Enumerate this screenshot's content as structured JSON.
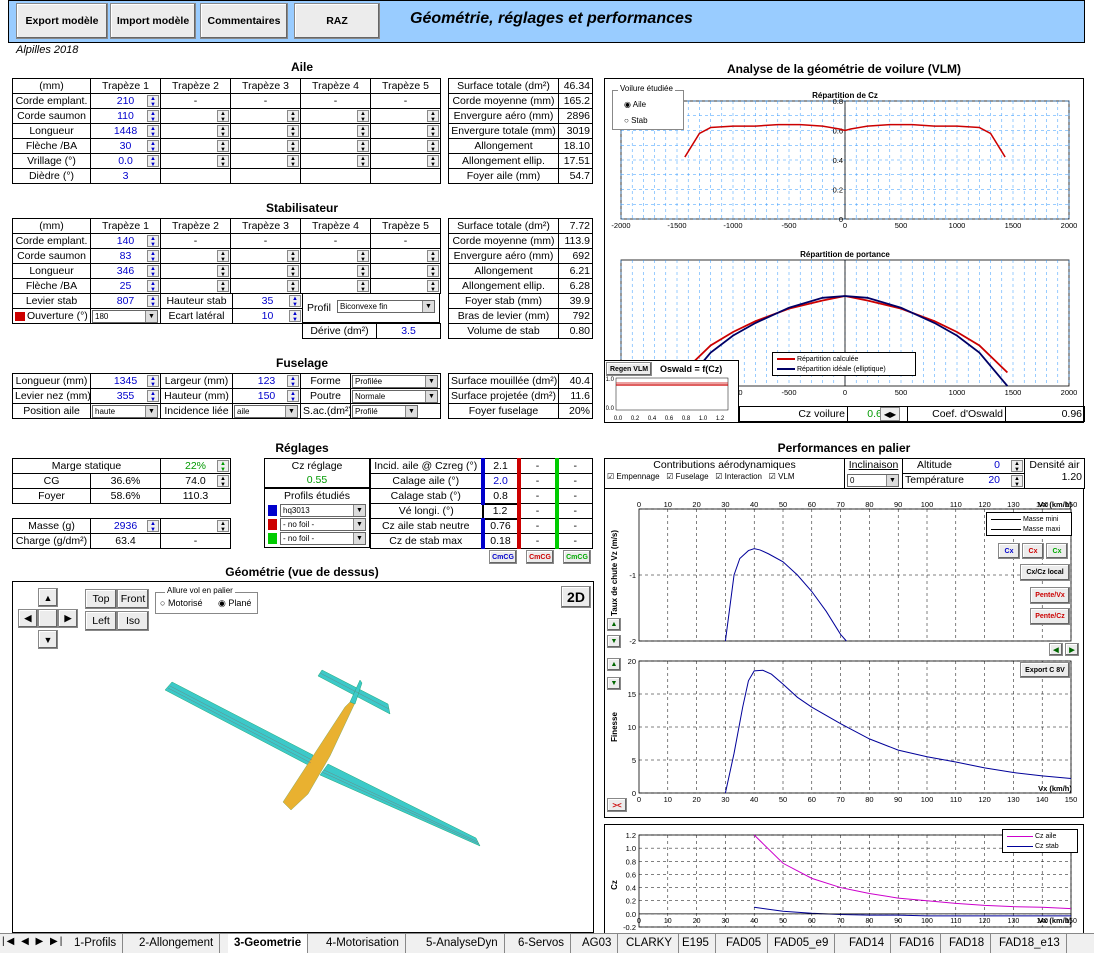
{
  "header": {
    "buttons": [
      "Export modèle",
      "Import modèle",
      "Commentaires",
      "RAZ"
    ],
    "title": "Géométrie, réglages et performances",
    "subtitle": "Alpilles 2018"
  },
  "aile": {
    "title": "Aile",
    "cols": [
      "(mm)",
      "Trapèze 1",
      "Trapèze 2",
      "Trapèze 3",
      "Trapèze 4",
      "Trapèze 5"
    ],
    "rows": [
      [
        "Corde emplant.",
        "210",
        "-",
        "-",
        "-",
        "-"
      ],
      [
        "Corde saumon",
        "110",
        "",
        "",
        "",
        ""
      ],
      [
        "Longueur",
        "1448",
        "",
        "",
        "",
        ""
      ],
      [
        "Flèche /BA",
        "30",
        "",
        "",
        "",
        ""
      ],
      [
        "Vrillage (°)",
        "0.0",
        "",
        "",
        "",
        ""
      ],
      [
        "Dièdre (°)",
        "3",
        "",
        "",
        "",
        ""
      ]
    ],
    "stats": [
      [
        "Surface totale (dm²)",
        "46.34"
      ],
      [
        "Corde moyenne (mm)",
        "165.2"
      ],
      [
        "Envergure aéro (mm)",
        "2896"
      ],
      [
        "Envergure totale (mm)",
        "3019"
      ],
      [
        "Allongement",
        "18.10"
      ],
      [
        "Allongement ellip.",
        "17.51"
      ],
      [
        "Foyer aile (mm)",
        "54.7"
      ]
    ]
  },
  "stab": {
    "title": "Stabilisateur",
    "cols": [
      "(mm)",
      "Trapèze 1",
      "Trapèze 2",
      "Trapèze 3",
      "Trapèze 4",
      "Trapèze 5"
    ],
    "rows": [
      [
        "Corde emplant.",
        "140",
        "-",
        "-",
        "-",
        "-"
      ],
      [
        "Corde saumon",
        "83",
        "",
        "",
        "",
        ""
      ],
      [
        "Longueur",
        "346",
        "",
        "",
        "",
        ""
      ],
      [
        "Flèche /BA",
        "25",
        "",
        "",
        "",
        ""
      ]
    ],
    "levier": [
      "Levier stab",
      "807"
    ],
    "hauteur": [
      "Hauteur stab",
      "35"
    ],
    "ouverture": [
      "Ouverture (°)",
      "180"
    ],
    "ecart": [
      "Ecart latéral",
      "10"
    ],
    "profil": [
      "Profil",
      "Biconvexe fin"
    ],
    "derive": [
      "Dérive (dm²)",
      "3.5"
    ],
    "stats": [
      [
        "Surface totale (dm²)",
        "7.72"
      ],
      [
        "Corde moyenne (mm)",
        "113.9"
      ],
      [
        "Envergure aéro (mm)",
        "692"
      ],
      [
        "Allongement",
        "6.21"
      ],
      [
        "Allongement ellip.",
        "6.28"
      ],
      [
        "Foyer stab (mm)",
        "39.9"
      ],
      [
        "Bras de levier (mm)",
        "792"
      ],
      [
        "Volume de stab",
        "0.80"
      ]
    ]
  },
  "fuselage": {
    "title": "Fuselage",
    "longueur": [
      "Longueur (mm)",
      "1345"
    ],
    "largeur": [
      "Largeur (mm)",
      "123"
    ],
    "forme": [
      "Forme",
      "Profilée"
    ],
    "levier_nez": [
      "Levier nez (mm)",
      "355"
    ],
    "hauteur": [
      "Hauteur (mm)",
      "150"
    ],
    "poutre": [
      "Poutre",
      "Normale"
    ],
    "position": [
      "Position aile",
      "haute"
    ],
    "incidence": [
      "Incidence liée",
      "aile"
    ],
    "sac": [
      "S.ac.(dm²)",
      "Profilé"
    ],
    "stats": [
      [
        "Surface mouillée (dm²)",
        "40.4"
      ],
      [
        "Surface projetée (dm²)",
        "11.6"
      ],
      [
        "Foyer fuselage",
        "20%"
      ]
    ]
  },
  "reglages": {
    "title": "Réglages",
    "marge": [
      "Marge statique",
      "22%"
    ],
    "cg": [
      "CG",
      "36.6%",
      "74.0"
    ],
    "foyer": [
      "Foyer",
      "58.6%",
      "110.3"
    ],
    "masse": [
      "Masse (g)",
      "2936"
    ],
    "charge": [
      "Charge (g/dm²)",
      "63.4",
      "-"
    ],
    "czreg": [
      "Cz réglage",
      "0.55"
    ],
    "profils_title": "Profils étudiés",
    "profils": [
      "hq3013",
      "- no foil -",
      "- no foil -"
    ],
    "profil_colors": [
      "#0000cc",
      "#cc0000",
      "#00cc00"
    ],
    "incid": [
      [
        "Incid. aile @ Czreg (°)",
        "2.1",
        "-",
        "-"
      ],
      [
        "Calage aile (°)",
        "2.0",
        "-",
        "-"
      ],
      [
        "Calage stab (°)",
        "0.8",
        "-",
        "-"
      ],
      [
        "Vé longi. (°)",
        "1.2",
        "-",
        "-"
      ],
      [
        "Cz aile stab neutre",
        "0.76",
        "-",
        "-"
      ],
      [
        "Cz de stab max",
        "0.18",
        "-",
        "-"
      ]
    ],
    "cmcg": [
      "CmCG",
      "CmCG",
      "CmCG"
    ]
  },
  "geom": {
    "title": "Géométrie (vue de dessus)",
    "views": [
      "Top",
      "Front",
      "Left",
      "Iso"
    ],
    "allure_title": "Allure vol en palier",
    "allure": [
      "Motorisé",
      "Plané"
    ],
    "mode": "2D"
  },
  "vlm": {
    "title": "Analyse de la géométrie de voilure (VLM)",
    "voilure_title": "Voilure étudiée",
    "voilure": [
      "Aile",
      "Stab"
    ],
    "chart1_title": "Répartition de Cz",
    "chart2_title": "Répartition de portance",
    "legend2": [
      "Répartition calculée",
      "Répartition idéale (elliptique)"
    ],
    "regen": "Regen VLM",
    "oswald_title": "Oswald = f(Cz)",
    "cz_voilure": [
      "Cz voilure",
      "0.60"
    ],
    "coef_oswald": [
      "Coef. d'Oswald",
      "0.96"
    ]
  },
  "perf": {
    "title": "Performances en palier",
    "contrib_title": "Contributions aérodynamiques",
    "contrib": [
      "Empennage",
      "Fuselage",
      "Interaction",
      "VLM"
    ],
    "inclinaison": [
      "Inclinaison",
      "0"
    ],
    "altitude": [
      "Altitude",
      "0"
    ],
    "temperature": [
      "Température",
      "20"
    ],
    "densite": [
      "Densité air",
      "1.20"
    ],
    "legend1": [
      "Masse mini",
      "Masse maxi"
    ],
    "btns": [
      "Cx",
      "Cx",
      "Cx",
      "Cx/Cz local",
      "Pente/Vx",
      "Pente/Cz",
      "Export C 8V"
    ],
    "ylab1": "Taux de chute Vz (m/s)",
    "ylab2": "Finesse",
    "ylab3": "Cz",
    "xlab": "Vx (km/h)",
    "legend3": [
      "Cz aile",
      "Cz stab"
    ]
  },
  "chart_data": [
    {
      "type": "line",
      "title": "Répartition de Cz",
      "x": [
        -1430,
        -1300,
        -1200,
        -1000,
        -800,
        -600,
        -400,
        -200,
        -50,
        0,
        50,
        200,
        400,
        600,
        800,
        1000,
        1200,
        1300,
        1430
      ],
      "series": [
        {
          "values": [
            0.42,
            0.58,
            0.62,
            0.63,
            0.63,
            0.64,
            0.64,
            0.63,
            0.61,
            0.6,
            0.61,
            0.63,
            0.64,
            0.64,
            0.63,
            0.63,
            0.62,
            0.58,
            0.42
          ]
        }
      ],
      "xlim": [
        -2000,
        2000
      ],
      "ylim": [
        0,
        0.8
      ]
    },
    {
      "type": "line",
      "title": "Répartition de portance",
      "x": [
        -1450,
        -1200,
        -1000,
        -800,
        -500,
        -200,
        0,
        200,
        500,
        800,
        1000,
        1200,
        1450
      ],
      "series": [
        {
          "name": "Répartition calculée",
          "values": [
            0.15,
            0.45,
            0.6,
            0.72,
            0.86,
            0.95,
            1,
            0.95,
            0.86,
            0.72,
            0.6,
            0.45,
            0.15
          ]
        },
        {
          "name": "Répartition idéale (elliptique)",
          "values": [
            0,
            0.37,
            0.56,
            0.7,
            0.87,
            0.98,
            1,
            0.98,
            0.87,
            0.7,
            0.56,
            0.37,
            0
          ]
        }
      ],
      "xlim": [
        -2000,
        2000
      ]
    },
    {
      "type": "line",
      "title": "Taux de chute",
      "xlabel": "Vx (km/h)",
      "ylabel": "Taux de chute Vz (m/s)",
      "x": [
        30,
        33,
        35,
        38,
        40,
        42,
        45,
        50,
        55,
        60,
        65,
        70,
        72
      ],
      "series": [
        {
          "name": "Masse mini",
          "values": [
            -2,
            -1,
            -0.75,
            -0.63,
            -0.6,
            -0.62,
            -0.68,
            -0.8,
            -1.0,
            -1.25,
            -1.55,
            -1.9,
            -2.0
          ]
        }
      ],
      "xlim": [
        0,
        150
      ],
      "ylim": [
        -2,
        0
      ]
    },
    {
      "type": "line",
      "title": "Finesse",
      "xlabel": "Vx (km/h)",
      "ylabel": "Finesse",
      "x": [
        30,
        33,
        36,
        38,
        40,
        43,
        46,
        50,
        55,
        60,
        70,
        80,
        90,
        100,
        110,
        120,
        130,
        140,
        150
      ],
      "series": [
        {
          "values": [
            0,
            6,
            13,
            17,
            18.5,
            18.6,
            18,
            16.5,
            14.5,
            13,
            10.5,
            8.2,
            6.5,
            5.5,
            4.7,
            3.8,
            3.1,
            2.6,
            2.2
          ]
        }
      ],
      "xlim": [
        0,
        150
      ],
      "ylim": [
        0,
        20
      ]
    },
    {
      "type": "line",
      "title": "Cz",
      "xlabel": "Vx (km/h)",
      "ylabel": "Cz",
      "x": [
        40,
        50,
        60,
        70,
        80,
        90,
        100,
        110,
        120,
        130,
        140,
        150
      ],
      "series": [
        {
          "name": "Cz aile",
          "values": [
            1.2,
            0.77,
            0.54,
            0.4,
            0.31,
            0.24,
            0.2,
            0.16,
            0.13,
            0.11,
            0.1,
            0.08
          ]
        },
        {
          "name": "Cz stab",
          "values": [
            0.1,
            0.04,
            0.01,
            -0.01,
            -0.02,
            -0.02,
            -0.03,
            -0.03,
            -0.03,
            -0.03,
            -0.03,
            -0.03
          ]
        }
      ],
      "xlim": [
        0,
        150
      ],
      "ylim": [
        -0.2,
        1.2
      ]
    }
  ],
  "sheets": [
    "1-Profils",
    "2-Allongement",
    "3-Geometrie",
    "4-Motorisation",
    "5-AnalyseDyn",
    "6-Servos",
    "AG03",
    "CLARKY",
    "E195",
    "FAD05",
    "FAD05_e9",
    "FAD14",
    "FAD16",
    "FAD18",
    "FAD18_e13"
  ]
}
